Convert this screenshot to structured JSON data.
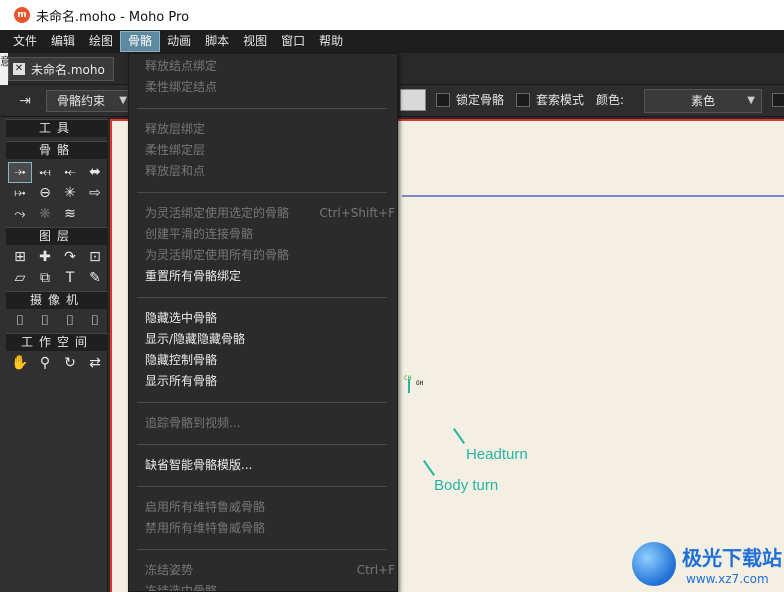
{
  "window": {
    "title": "未命名.moho - Moho Pro",
    "logo_text": "m"
  },
  "menubar": {
    "items": [
      "文件",
      "编辑",
      "绘图",
      "骨骼",
      "动画",
      "脚本",
      "视图",
      "窗口",
      "帮助"
    ],
    "active_index": 3
  },
  "doc_tab": {
    "close": "✕",
    "label": "未命名.moho",
    "left_edge": "意"
  },
  "toolbar": {
    "bone_constraint": "骨骼约束",
    "lock_bone": "锁定骨骼",
    "pixel_mode": "套索模式",
    "color_label": "颜色:",
    "color_value": "素色",
    "caret": "▼"
  },
  "tools": {
    "heading": "工具",
    "bone_section": "骨骼",
    "layer_section": "图层",
    "camera_section": "摄像机",
    "workspace_section": "工作空间"
  },
  "canvas": {
    "headturn": "Headturn",
    "bodyturn": "Body turn",
    "mark1": "CH",
    "mark2": "OH"
  },
  "watermark": {
    "title": "极光下载站",
    "url": "www.xz7.com"
  },
  "bone_menu": {
    "items": [
      {
        "label": "释放结点绑定",
        "disabled": true,
        "shortcut": ""
      },
      {
        "label": "柔性绑定结点",
        "disabled": true,
        "shortcut": ""
      },
      {
        "label": "释放层绑定",
        "disabled": true,
        "shortcut": ""
      },
      {
        "label": "柔性绑定层",
        "disabled": true,
        "shortcut": ""
      },
      {
        "label": "释放层和点",
        "disabled": true,
        "shortcut": ""
      },
      {
        "label": "为灵活绑定使用选定的骨骼",
        "disabled": true,
        "shortcut": "Ctrl+Shift+F"
      },
      {
        "label": "创建平滑的连接骨骼",
        "disabled": true,
        "shortcut": ""
      },
      {
        "label": "为灵活绑定使用所有的骨骼",
        "disabled": true,
        "shortcut": ""
      },
      {
        "label": "重置所有骨骼绑定",
        "disabled": false,
        "shortcut": ""
      },
      {
        "label": "隐藏选中骨骼",
        "disabled": false,
        "shortcut": ""
      },
      {
        "label": "显示/隐藏隐藏骨骼",
        "disabled": false,
        "shortcut": ""
      },
      {
        "label": "隐藏控制骨骼",
        "disabled": false,
        "shortcut": ""
      },
      {
        "label": "显示所有骨骼",
        "disabled": false,
        "shortcut": ""
      },
      {
        "label": "追踪骨骼到视频...",
        "disabled": true,
        "shortcut": ""
      },
      {
        "label": "缺省智能骨骼模版...",
        "disabled": false,
        "shortcut": ""
      },
      {
        "label": "启用所有维特鲁威骨骼",
        "disabled": true,
        "shortcut": ""
      },
      {
        "label": "禁用所有维特鲁威骨骼",
        "disabled": true,
        "shortcut": ""
      },
      {
        "label": "冻结姿势",
        "disabled": true,
        "shortcut": "Ctrl+F"
      },
      {
        "label": "冻结选中骨骼",
        "disabled": true,
        "shortcut": ""
      }
    ]
  },
  "icons": [
    "app-logo-icon",
    "close-icon",
    "bone-select-icon",
    "caret-down-icon",
    "hand-icon",
    "magnifier-icon",
    "rotate-icon",
    "orbit-icon",
    "text-icon",
    "eyedropper-icon",
    "camera-icon"
  ]
}
